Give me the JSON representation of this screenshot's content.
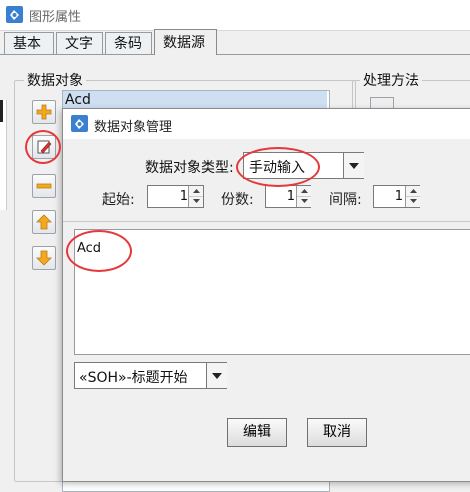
{
  "back_window": {
    "title": "图形属性",
    "app_icon": "app-logo-icon",
    "tabs": [
      {
        "label": "基本",
        "active": false
      },
      {
        "label": "文字",
        "active": false
      },
      {
        "label": "条码",
        "active": false
      },
      {
        "label": "数据源",
        "active": true
      }
    ],
    "data_object_group_label": "数据对象",
    "process_group_label": "处理方法",
    "data_objects": [
      "Acd"
    ],
    "side_buttons": [
      "add-icon",
      "edit-icon",
      "remove-icon",
      "move-up-icon",
      "move-down-icon"
    ]
  },
  "dialog": {
    "title": "数据对象管理",
    "app_icon": "app-logo-icon",
    "type_label": "数据对象类型:",
    "type_value": "手动输入",
    "start_label": "起始:",
    "start_value": "1",
    "copies_label": "份数:",
    "copies_value": "1",
    "interval_label": "间隔:",
    "interval_value": "1",
    "content_text": "Acd",
    "control_char_value": "«SOH»-标题开始",
    "edit_button": "编辑",
    "cancel_button": "取消"
  },
  "colors": {
    "highlight_ring": "#e5383b",
    "selection": "#cfdff2",
    "add_icon": "#f2a91f",
    "remove_icon": "#f2a91f"
  }
}
